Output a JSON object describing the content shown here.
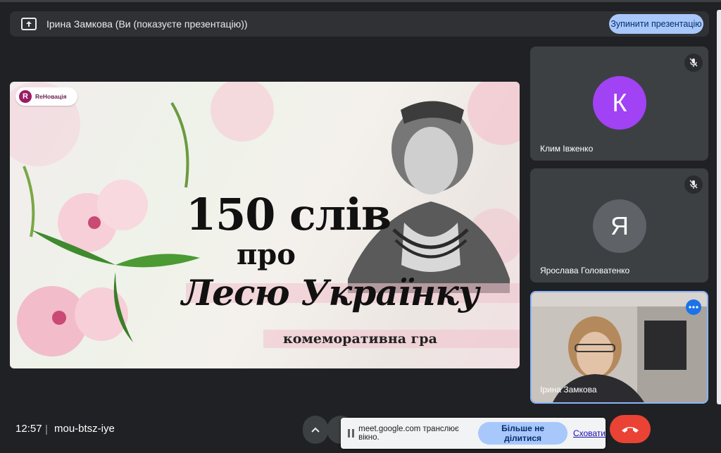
{
  "banner": {
    "presenter_text": "Ірина Замкова (Ви (показуєте презентацію))",
    "stop_button_label": "Зупинити презентацію"
  },
  "slide": {
    "logo_text": "ReНовація",
    "logo_letter": "R",
    "title_line1": "150 слів",
    "title_line2": "про",
    "title_line3": "Лесю Українку",
    "subtitle": "комеморативна гра"
  },
  "participants": [
    {
      "name": "Клим Івженко",
      "initial": "К",
      "avatar_color": "#a142f4",
      "muted": true
    },
    {
      "name": "Ярослава Головатенко",
      "initial": "Я",
      "avatar_color": "#5f6368",
      "muted": true
    },
    {
      "name": "Ірина Замкова",
      "camera": "on"
    }
  ],
  "bottom_bar": {
    "time": "12:57",
    "separator": "|",
    "meeting_code": "mou-btsz-iye"
  },
  "share_bar": {
    "message": "meet.google.com транслює вікно.",
    "stop_share_label": "Більше не ділитися",
    "hide_label": "Сховати"
  },
  "colors": {
    "accent": "#a8c7fa",
    "end_call": "#ea4335",
    "background": "#202124"
  }
}
